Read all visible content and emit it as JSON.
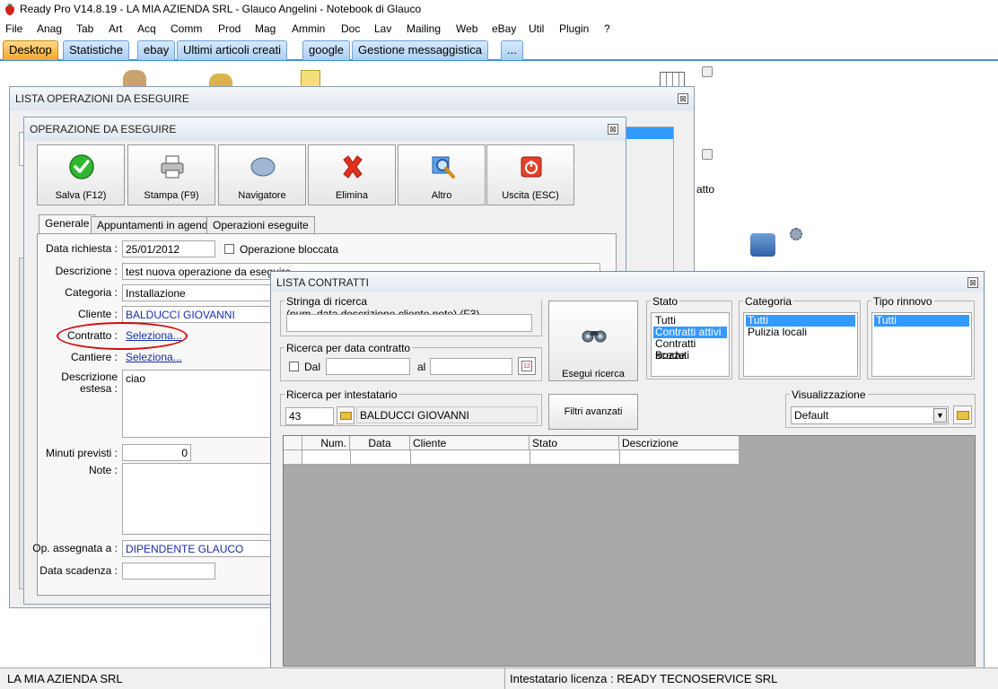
{
  "app": {
    "title": "Ready Pro V14.8.19 - LA MIA AZIENDA SRL - Glauco Angelini - Notebook di Glauco"
  },
  "menu": [
    "File",
    "Anag",
    "Tab",
    "Art",
    "Acq",
    "Comm",
    "Prod",
    "Mag",
    "Ammin",
    "Doc",
    "Lav",
    "Mailing",
    "Web",
    "eBay",
    "Util",
    "Plugin",
    "?"
  ],
  "tabs": [
    "Desktop",
    "Statistiche",
    "ebay",
    "Ultimi articoli creati",
    "google",
    "Gestione messaggistica",
    "..."
  ],
  "desktop": {
    "partial_text": "atto"
  },
  "lista_operazioni": {
    "title": "LISTA OPERAZIONI DA ESEGUIRE",
    "close": "⊠"
  },
  "operazione": {
    "title": "OPERAZIONE DA ESEGUIRE",
    "close": "⊠",
    "toolbar": {
      "save": "Salva (F12)",
      "print": "Stampa (F9)",
      "navigator": "Navigatore",
      "delete": "Elimina",
      "other": "Altro",
      "exit": "Uscita (ESC)"
    },
    "tabs": [
      "Generale",
      "Appuntamenti in agenda",
      "Operazioni eseguite"
    ],
    "fields": {
      "data_richiesta_label": "Data richiesta :",
      "data_richiesta": "25/01/2012",
      "bloccata_label": "Operazione bloccata",
      "descrizione_label": "Descrizione :",
      "descrizione": "test nuova operazione da eseguire",
      "categoria_label": "Categoria :",
      "categoria": "Installazione",
      "cliente_label": "Cliente :",
      "cliente": "BALDUCCI GIOVANNI",
      "contratto_label": "Contratto :",
      "contratto": "Seleziona...",
      "cantiere_label": "Cantiere :",
      "cantiere": "Seleziona...",
      "descr_estesa_label_1": "Descrizione",
      "descr_estesa_label_2": "estesa :",
      "descr_estesa": "ciao",
      "minuti_label": "Minuti previsti :",
      "minuti": "0",
      "note_label": "Note :",
      "assegnata_label": "Op. assegnata a :",
      "assegnata": "DIPENDENTE GLAUCO",
      "scadenza_label": "Data scadenza :"
    }
  },
  "lista_contratti": {
    "title": "LISTA CONTRATTI",
    "close": "⊠",
    "search_group": "Stringa di ricerca (num.,data,descrizione,cliente,note) (F3)",
    "date_group": "Ricerca per data contratto",
    "dal_label": "Dal",
    "al_label": "al",
    "intestatario_group": "Ricerca per intestatario",
    "intestatario_code": "43",
    "intestatario_name": "BALDUCCI GIOVANNI",
    "run_search": "Esegui ricerca",
    "advanced_filters": "Filtri avanzati",
    "stato_group": "Stato",
    "stato_items": [
      "Tutti",
      "Contratti attivi",
      "Contratti scaduti",
      "Bozze"
    ],
    "categoria_group": "Categoria",
    "categoria_items": [
      "Tutti",
      "Pulizia locali"
    ],
    "rinnovo_group": "Tipo rinnovo",
    "rinnovo_items": [
      "Tutti"
    ],
    "visual_group": "Visualizzazione",
    "visual_value": "Default",
    "columns": [
      "Num.",
      "Data",
      "Cliente",
      "Stato",
      "Descrizione"
    ]
  },
  "status": {
    "left": "LA MIA AZIENDA SRL",
    "right": "Intestatario licenza : READY TECNOSERVICE SRL"
  },
  "colors": {
    "selection": "#3399ff",
    "link": "#1a2ea8",
    "highlight_ring": "#d01010",
    "active_tab": "#f5a623"
  }
}
